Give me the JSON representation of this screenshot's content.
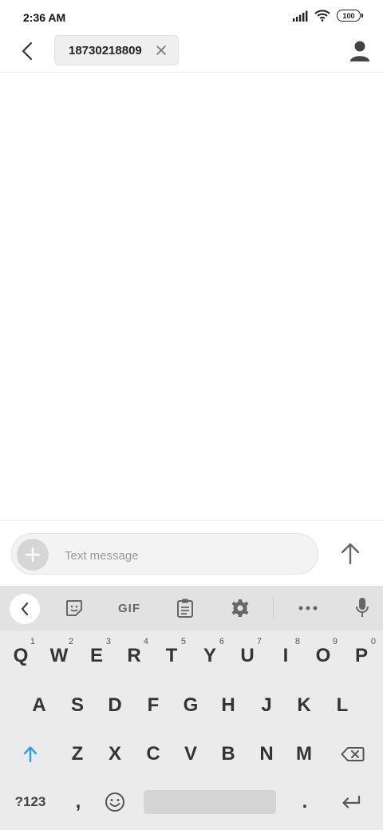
{
  "status_bar": {
    "time": "2:36 AM",
    "battery": "100",
    "icons": [
      "signal-icon",
      "wifi-icon",
      "battery-icon"
    ]
  },
  "header": {
    "recipient": "18730218809",
    "back_icon": "back-arrow-icon",
    "remove_icon": "close-icon",
    "contact_icon": "person-icon"
  },
  "compose": {
    "placeholder": "Text message",
    "attach_icon": "plus-icon",
    "send_icon": "arrow-up-icon"
  },
  "keyboard": {
    "toolbar": {
      "gif_label": "GIF",
      "icons": [
        "chevron-left-icon",
        "sticker-icon",
        "clipboard-icon",
        "gear-icon",
        "more-icon",
        "mic-icon"
      ]
    },
    "row1": [
      {
        "key": "Q",
        "hint": "1"
      },
      {
        "key": "W",
        "hint": "2"
      },
      {
        "key": "E",
        "hint": "3"
      },
      {
        "key": "R",
        "hint": "4"
      },
      {
        "key": "T",
        "hint": "5"
      },
      {
        "key": "Y",
        "hint": "6"
      },
      {
        "key": "U",
        "hint": "7"
      },
      {
        "key": "I",
        "hint": "8"
      },
      {
        "key": "O",
        "hint": "9"
      },
      {
        "key": "P",
        "hint": "0"
      }
    ],
    "row2": [
      "A",
      "S",
      "D",
      "F",
      "G",
      "H",
      "J",
      "K",
      "L"
    ],
    "row3": [
      "Z",
      "X",
      "C",
      "V",
      "B",
      "N",
      "M"
    ],
    "row4": {
      "symbols": "?123",
      "comma": ",",
      "period": "."
    },
    "accent_color": "#2a9df4"
  }
}
